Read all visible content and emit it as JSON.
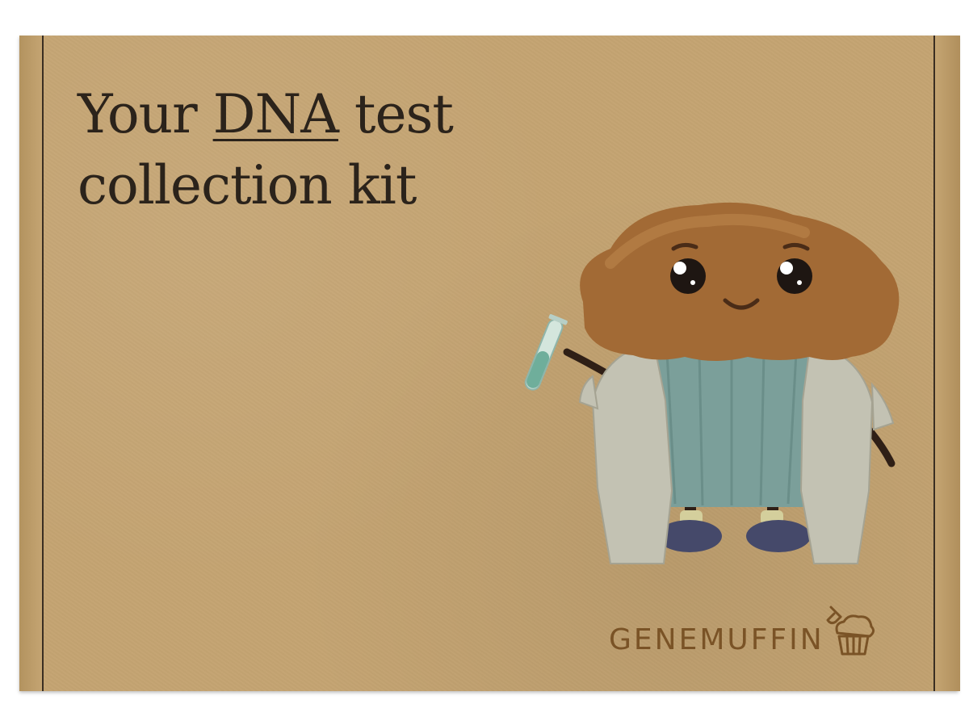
{
  "headline": {
    "line1_before": "Your ",
    "line1_emphasis": "DNA",
    "line1_after": " test",
    "line2": "collection kit"
  },
  "brand": {
    "name": "GENEMUFFIN",
    "logo_icon": "muffin-with-test-tube-icon"
  },
  "mascot": {
    "icon": "muffin-scientist-mascot"
  },
  "colors": {
    "cardboard": "#c4a472",
    "text": "#2b231b",
    "brand": "#7a5326",
    "muffin_top": "#a26a35",
    "cup": "#7b9f9a",
    "coat": "#c3c2b3"
  }
}
